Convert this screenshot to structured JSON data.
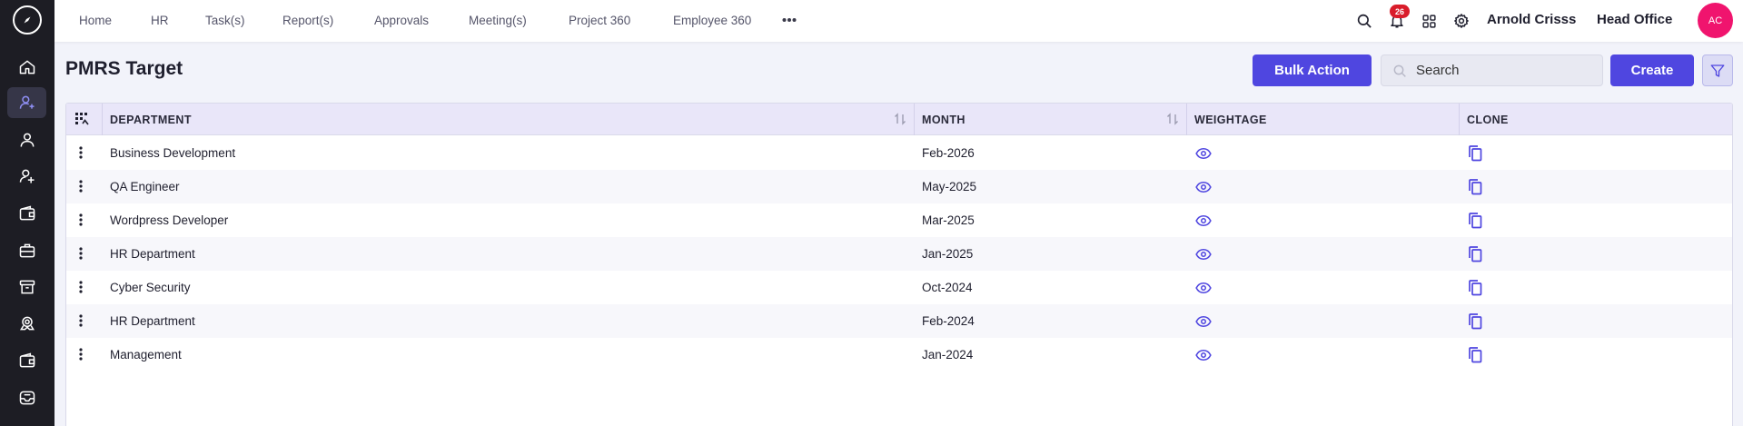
{
  "nav": {
    "items": [
      "Home",
      "HR",
      "Task(s)",
      "Report(s)",
      "Approvals",
      "Meeting(s)",
      "Project 360",
      "Employee 360"
    ]
  },
  "topbar": {
    "notification_count": "26",
    "user_name": "Arnold Crisss",
    "office": "Head Office",
    "avatar_initials": "AC"
  },
  "page": {
    "title": "PMRS Target",
    "bulk_action_label": "Bulk Action",
    "search_placeholder": "Search",
    "create_label": "Create"
  },
  "table": {
    "columns": [
      "DEPARTMENT",
      "MONTH",
      "WEIGHTAGE",
      "CLONE"
    ],
    "rows": [
      {
        "department": "Business Development",
        "month": "Feb-2026"
      },
      {
        "department": "QA Engineer",
        "month": "May-2025"
      },
      {
        "department": "Wordpress Developer",
        "month": "Mar-2025"
      },
      {
        "department": "HR Department",
        "month": "Jan-2025"
      },
      {
        "department": "Cyber Security",
        "month": "Oct-2024"
      },
      {
        "department": "HR Department",
        "month": "Feb-2024"
      },
      {
        "department": "Management",
        "month": "Jan-2024"
      }
    ]
  },
  "colors": {
    "accent": "#4f46e0",
    "sidebar": "#1d1d24",
    "header_bg": "#e9e6f9",
    "badge": "#d91c2a",
    "avatar": "#f0146e"
  },
  "icons": {
    "sidebar": [
      "home-icon",
      "user-plus-icon",
      "user-icon",
      "user-add-icon",
      "wallet-icon",
      "briefcase-icon",
      "archive-icon",
      "award-icon",
      "wallet-alt-icon",
      "inbox-icon"
    ],
    "row_actions": [
      "kebab-icon",
      "eye-icon",
      "copy-icon"
    ]
  }
}
